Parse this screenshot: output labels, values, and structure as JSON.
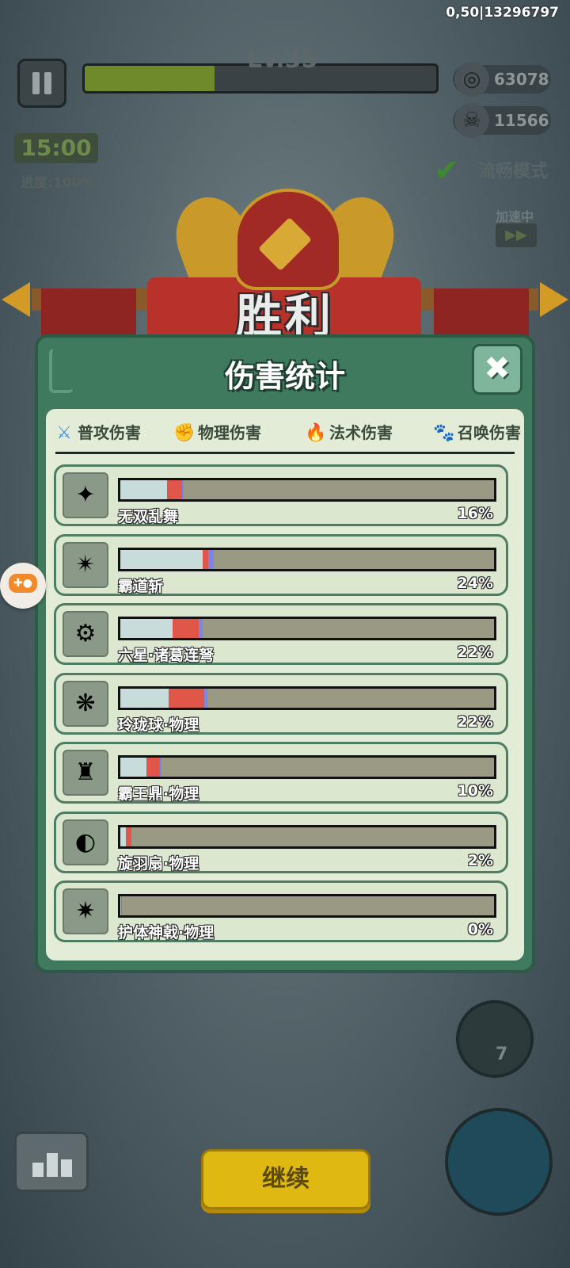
{
  "hud": {
    "debug_text": "0,50|13296797",
    "level": "Lv.35",
    "xp_fraction": 0.37,
    "coins": "63078",
    "coin_icon": "coin-icon",
    "kills": "11566",
    "kill_icon": "skull-icon",
    "timer": "15:00",
    "progress": "进度:100%",
    "mode": "流畅模式",
    "speed_label": "加速中",
    "speed_glyph": "▶▶"
  },
  "victory": {
    "title": "胜利"
  },
  "panel": {
    "title": "伤害统计",
    "close_glyph": "✖",
    "tabs": [
      {
        "label": "普攻伤害",
        "icon": "sword-icon",
        "glyph": "⚔",
        "color": "#4a90d9"
      },
      {
        "label": "物理伤害",
        "icon": "fist-icon",
        "glyph": "✊",
        "color": "#d93a30"
      },
      {
        "label": "法术伤害",
        "icon": "flame-icon",
        "glyph": "🔥",
        "color": "#2a7ae0"
      },
      {
        "label": "召唤伤害",
        "icon": "paw-icon",
        "glyph": "🐾",
        "color": "#9a3ac9"
      }
    ],
    "rows": [
      {
        "name": "无双乱舞",
        "pct": "16%",
        "glyph": "✦",
        "icon": "ice-blades-icon",
        "attack": 0.125,
        "physical": 0.04,
        "magic": 0.005
      },
      {
        "name": "霸道斩",
        "pct": "24%",
        "glyph": "✴",
        "icon": "purple-slash-icon",
        "attack": 0.22,
        "physical": 0.015,
        "magic": 0.015
      },
      {
        "name": "六星·诸葛连弩",
        "pct": "22%",
        "glyph": "⚙",
        "icon": "crossbow-icon",
        "attack": 0.14,
        "physical": 0.07,
        "magic": 0.01
      },
      {
        "name": "玲珑球·物理",
        "pct": "22%",
        "glyph": "❋",
        "icon": "orb-icon",
        "attack": 0.13,
        "physical": 0.095,
        "magic": 0.008
      },
      {
        "name": "霸王鼎·物理",
        "pct": "10%",
        "glyph": "♜",
        "icon": "cauldron-icon",
        "attack": 0.07,
        "physical": 0.035,
        "magic": 0.005
      },
      {
        "name": "旋羽扇·物理",
        "pct": "2%",
        "glyph": "◐",
        "icon": "feather-fan-icon",
        "attack": 0.015,
        "physical": 0.015,
        "magic": 0
      },
      {
        "name": "护体神戟·物理",
        "pct": "0%",
        "glyph": "✷",
        "icon": "halberd-icon",
        "attack": 0.003,
        "physical": 0.002,
        "magic": 0
      }
    ]
  },
  "bottom": {
    "continue": "继续",
    "skill_count": "7",
    "gamepad_icon": "gamepad-icon"
  }
}
